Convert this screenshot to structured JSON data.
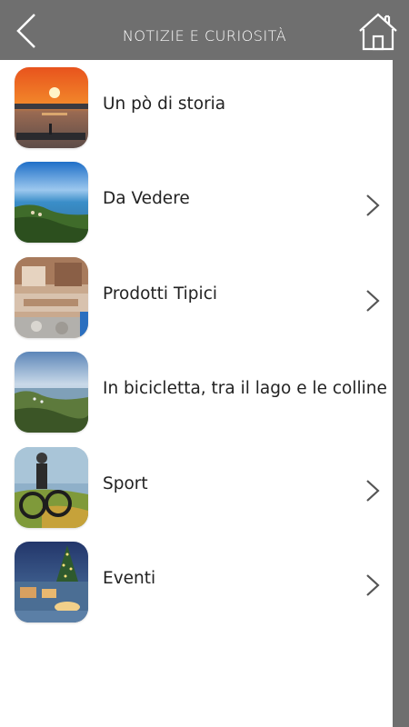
{
  "header": {
    "title": "NOTIZIE E CURIOSITÀ",
    "back_icon": "chevron-left-icon",
    "home_icon": "home-icon"
  },
  "colors": {
    "bar": "#6f6f6f",
    "text": "#222222",
    "chevron": "#555555"
  },
  "items": [
    {
      "label": "Un pò di storia",
      "thumb": "sunset-lake-photo",
      "has_chevron": false
    },
    {
      "label": "Da Vedere",
      "thumb": "coastline-photo",
      "has_chevron": true
    },
    {
      "label": "Prodotti Tipici",
      "thumb": "local-products-photo",
      "has_chevron": true
    },
    {
      "label": "In bicicletta, tra il lago e le colline",
      "thumb": "hills-lake-photo",
      "has_chevron": false
    },
    {
      "label": "Sport",
      "thumb": "mountain-bike-photo",
      "has_chevron": true
    },
    {
      "label": "Eventi",
      "thumb": "christmas-market-photo",
      "has_chevron": true
    }
  ]
}
